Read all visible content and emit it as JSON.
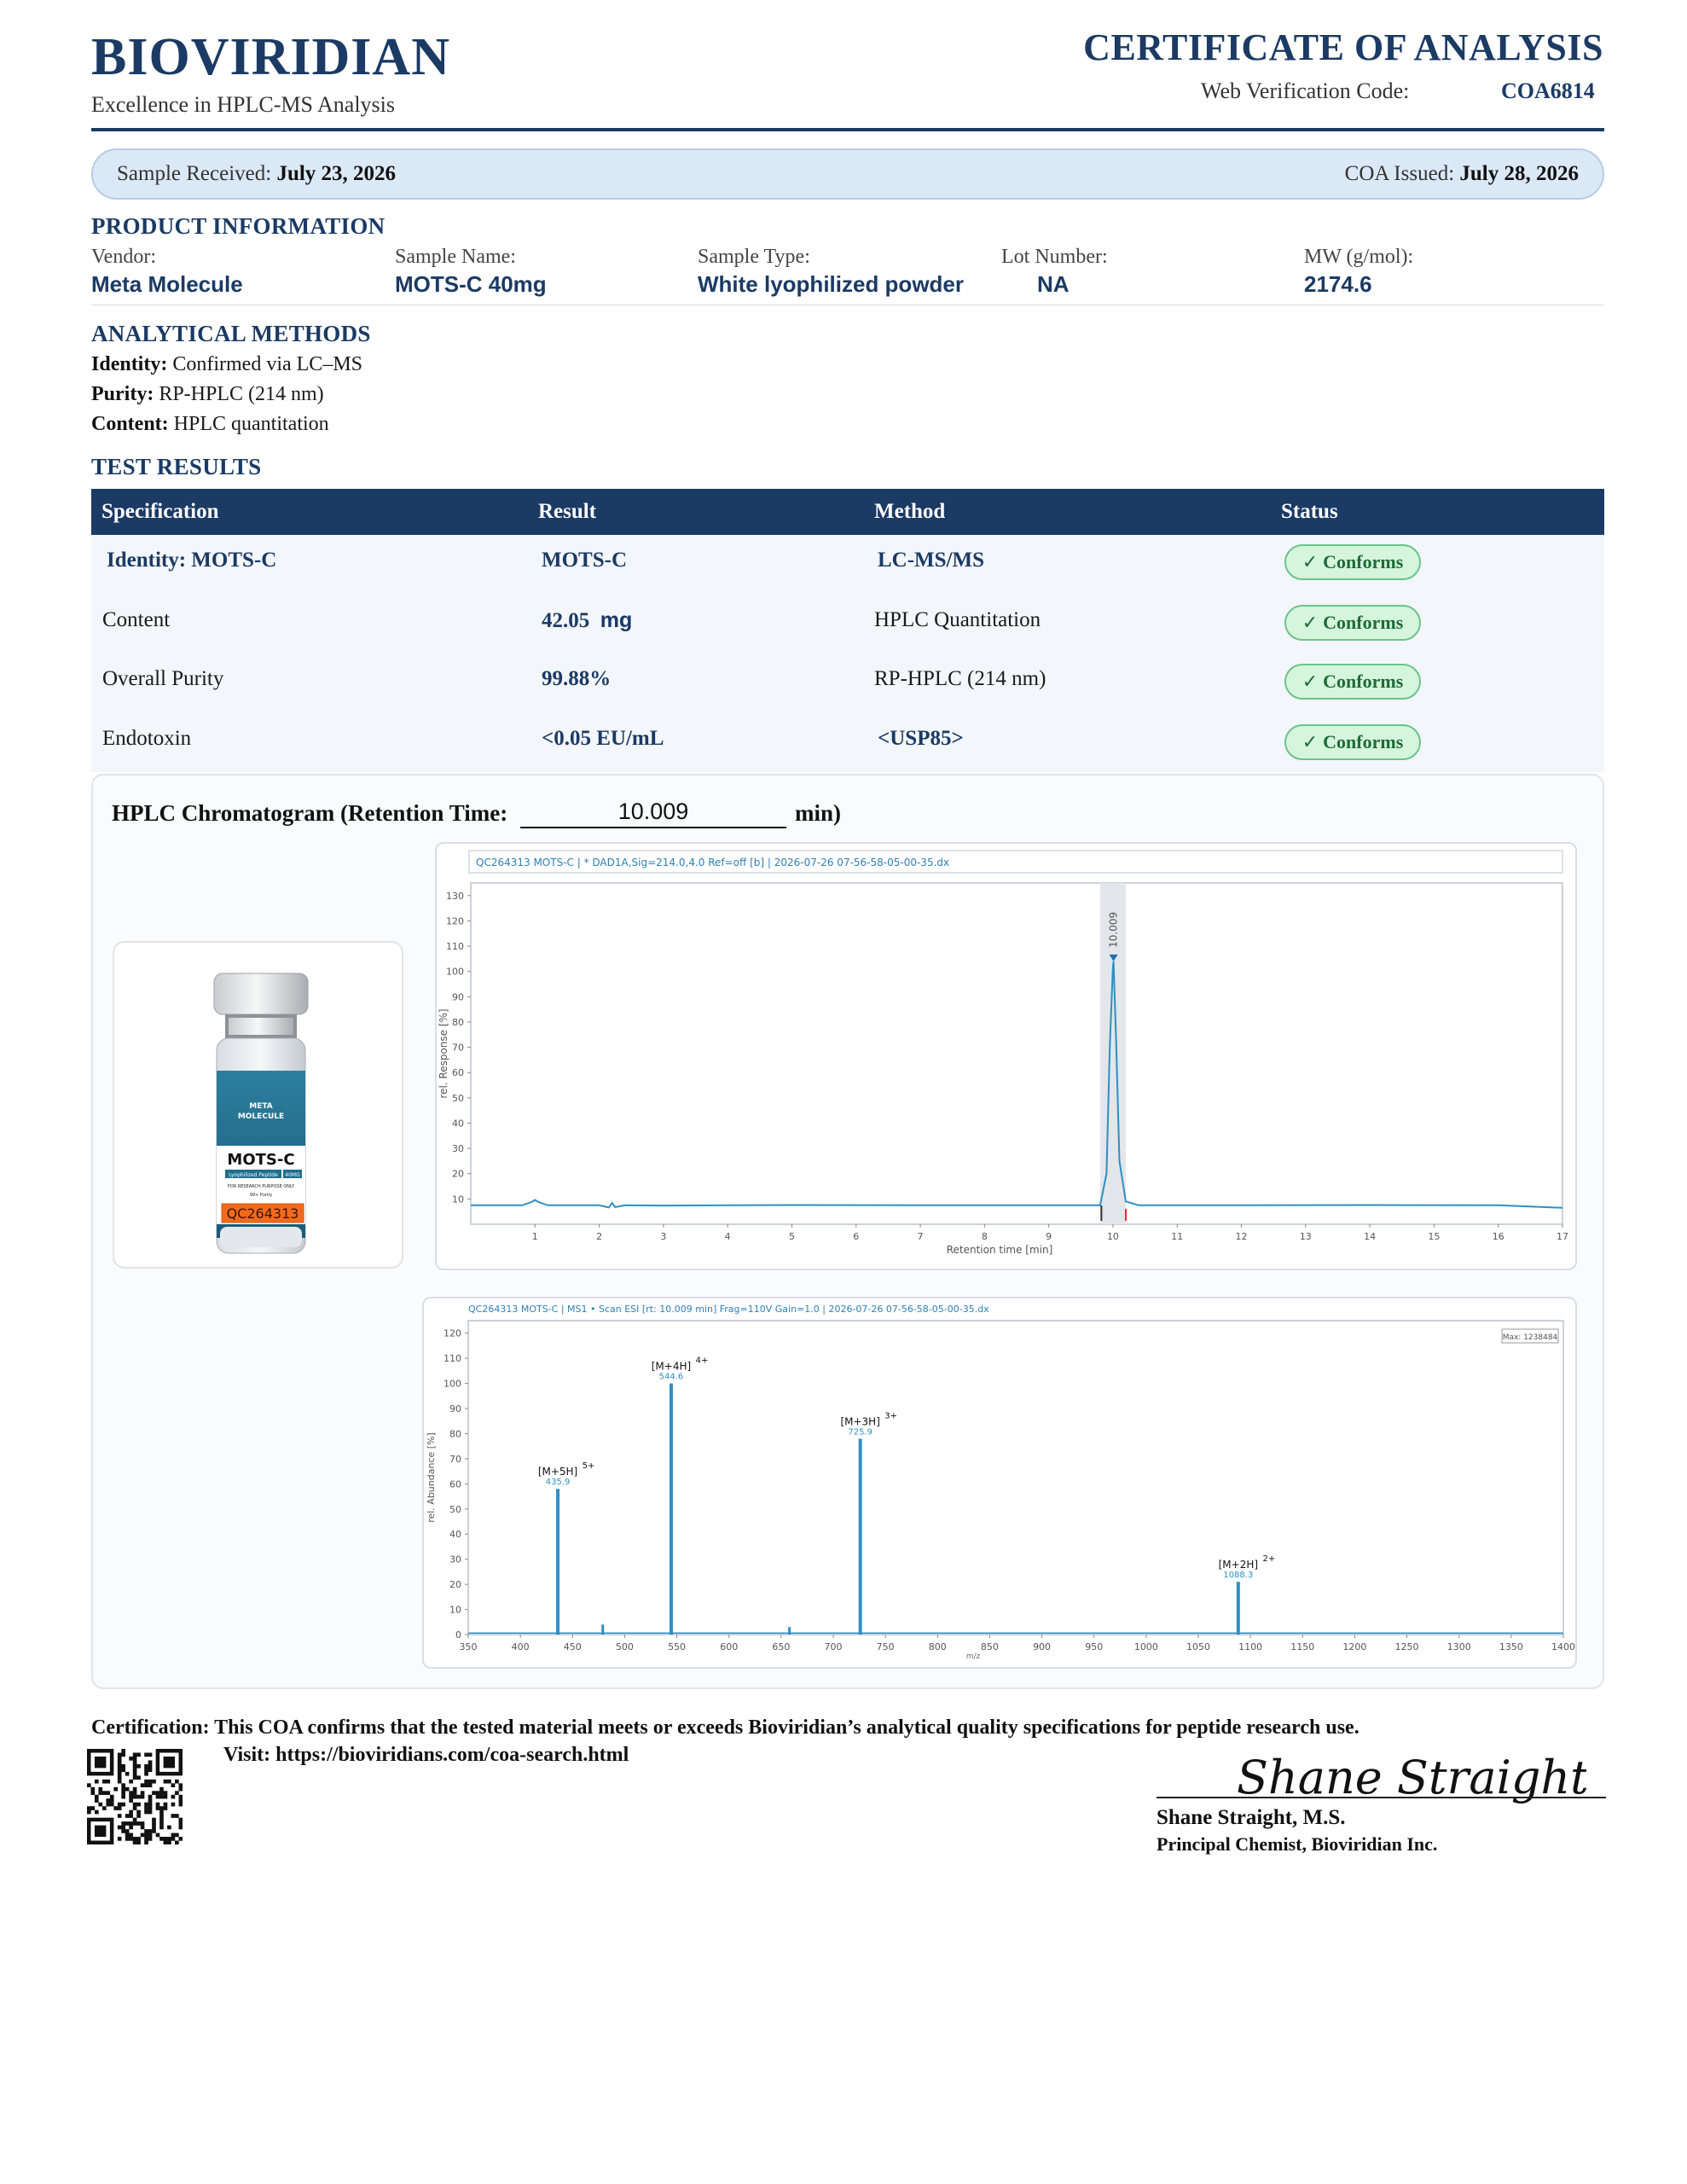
{
  "header": {
    "brand": "BIOVIRIDIAN",
    "tagline": "Excellence in HPLC-MS Analysis",
    "doc_title": "CERTIFICATE OF ANALYSIS",
    "verification_label": "Web Verification Code:",
    "verification_code": "COA6814"
  },
  "dates": {
    "received_label": "Sample Received:",
    "received_value": "July 23, 2026",
    "issued_label": "COA Issued:",
    "issued_value": "July 28, 2026"
  },
  "product_info": {
    "title": "PRODUCT INFORMATION",
    "fields": [
      {
        "label": "Vendor:",
        "value": "Meta Molecule"
      },
      {
        "label": "Sample Name:",
        "value": "MOTS-C 40mg"
      },
      {
        "label": "Sample Type:",
        "value": "White lyophilized powder"
      },
      {
        "label": "Lot Number:",
        "value": "NA"
      },
      {
        "label": "MW (g/mol):",
        "value": "2174.6"
      }
    ]
  },
  "methods": {
    "title": "ANALYTICAL METHODS",
    "lines": [
      {
        "label": "Identity:",
        "value": "Confirmed via LC–MS"
      },
      {
        "label": "Purity:",
        "value": "RP-HPLC (214 nm)"
      },
      {
        "label": "Content:",
        "value": "HPLC quantitation"
      }
    ]
  },
  "results": {
    "title": "TEST RESULTS",
    "headers": [
      "Specification",
      "Result",
      "Method",
      "Status"
    ],
    "check": "✓",
    "rows": [
      {
        "spec": "Identity:  MOTS-C",
        "result": "MOTS-C",
        "method": "LC-MS/MS",
        "status": "Conforms"
      },
      {
        "spec": "Content",
        "result": "42.05",
        "unit": "mg",
        "method": "HPLC Quantitation",
        "status": "Conforms"
      },
      {
        "spec": "Overall Purity",
        "result": "99.88%",
        "method": "RP-HPLC (214 nm)",
        "status": "Conforms"
      },
      {
        "spec": "Endotoxin",
        "result": "<0.05 EU/mL",
        "method": "<USP85>",
        "status": "Conforms"
      }
    ]
  },
  "chromatogram": {
    "title_prefix": "HPLC Chromatogram (Retention Time:",
    "retention_time": "10.009",
    "title_suffix": "min)"
  },
  "vial": {
    "brand_line1": "META",
    "brand_line2": "MOLECULE",
    "product": "MOTS-C",
    "sub": "Lyophilized Peptide",
    "dose": "40MG",
    "notice": "FOR RESEARCH PURPOSE ONLY",
    "purity": "99+ Purity",
    "lot_tag": "QC264313"
  },
  "chart_data": [
    {
      "type": "line",
      "title": "QC264313 MOTS-C | * DAD1A,Sig=214.0,4.0 Ref=off [b] | 2026-07-26 07-56-58-05-00-35.dx",
      "xlabel": "Retention time [min]",
      "ylabel": "rel. Response [%]",
      "xlim": [
        0,
        17
      ],
      "ylim": [
        0,
        135
      ],
      "xticks": [
        1,
        2,
        3,
        4,
        5,
        6,
        7,
        8,
        9,
        10,
        11,
        12,
        13,
        14,
        15,
        16,
        17
      ],
      "yticks": [
        10,
        20,
        30,
        40,
        50,
        60,
        70,
        80,
        90,
        100,
        110,
        120,
        130
      ],
      "peak_label": "10.009",
      "x": [
        0,
        0.8,
        0.95,
        1.0,
        1.05,
        1.2,
        2.0,
        2.15,
        2.2,
        2.25,
        2.4,
        3.0,
        5.0,
        7.0,
        9.0,
        9.8,
        9.9,
        9.95,
        10.0,
        10.009,
        10.05,
        10.1,
        10.2,
        10.4,
        12.0,
        14.0,
        16.0,
        17.0
      ],
      "y": [
        7.5,
        7.5,
        8.8,
        9.6,
        8.8,
        7.5,
        7.5,
        6.6,
        8.4,
        6.8,
        7.5,
        7.4,
        7.6,
        7.5,
        7.5,
        7.5,
        20,
        70,
        102,
        104,
        72,
        25,
        9,
        7.5,
        7.5,
        7.6,
        7.5,
        6.5
      ],
      "highlight_band": [
        9.8,
        10.2
      ]
    },
    {
      "type": "bar",
      "title": "QC264313 MOTS-C | MS1 • Scan ESI [rt: 10.009 min] Frag=110V Gain=1.0 | 2026-07-26 07-56-58-05-00-35.dx",
      "xlabel": "m/z",
      "ylabel": "rel. Abundance [%]",
      "max_label": "Max: 1238484",
      "xlim": [
        350,
        1400
      ],
      "ylim": [
        0,
        125
      ],
      "xticks": [
        350,
        400,
        450,
        500,
        550,
        600,
        650,
        700,
        750,
        800,
        850,
        900,
        950,
        1000,
        1050,
        1100,
        1150,
        1200,
        1250,
        1300,
        1350,
        1400
      ],
      "yticks": [
        0,
        10,
        20,
        30,
        40,
        50,
        60,
        70,
        80,
        90,
        100,
        110,
        120
      ],
      "peaks": [
        {
          "mz": 435.9,
          "value": 58,
          "ion": "[M+5H]",
          "charge": "5+",
          "mz_label": "435.9"
        },
        {
          "mz": 544.6,
          "value": 100,
          "ion": "[M+4H]",
          "charge": "4+",
          "mz_label": "544.6"
        },
        {
          "mz": 725.9,
          "value": 78,
          "ion": "[M+3H]",
          "charge": "3+",
          "mz_label": "725.9"
        },
        {
          "mz": 1088.3,
          "value": 21,
          "ion": "[M+2H]",
          "charge": "2+",
          "mz_label": "1088.3"
        }
      ],
      "minor_peaks": [
        {
          "mz": 479,
          "value": 4
        },
        {
          "mz": 658,
          "value": 3
        }
      ]
    }
  ],
  "footer": {
    "certification": "Certification: This COA confirms that the tested material meets or exceeds Bioviridian’s analytical quality specifications for peptide research use.",
    "visit": "Visit: https://bioviridians.com/coa-search.html",
    "signature_script": "Shane Straight",
    "signer_name": "Shane Straight, M.S.",
    "signer_title": "Principal Chemist, Bioviridian Inc."
  }
}
